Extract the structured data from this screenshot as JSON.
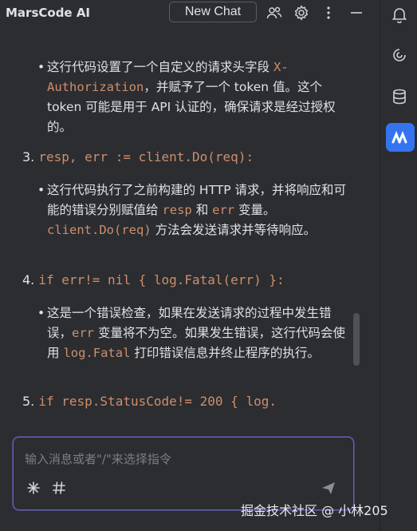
{
  "header": {
    "app_title": "MarsCode AI",
    "new_chat_label": "New Chat",
    "icons": [
      "users-icon",
      "gear-icon",
      "more-vertical-icon",
      "minimize-icon"
    ]
  },
  "rail": {
    "icons": [
      "bell-icon",
      "swirl-icon",
      "database-icon",
      "marscode-logo-icon"
    ]
  },
  "conversation": {
    "item2_bullet": {
      "p1": "这行代码设置了一个自定义的请求头字段 ",
      "code1": "X-Authorization",
      "p2": "，并赋予了一个 token 值。这个 token 可能是用于 API 认证的，确保请求是经过授权的。"
    },
    "item3": {
      "number": "3.",
      "code": "resp, err := client.Do(req):",
      "bullet": {
        "p1": "这行代码执行了之前构建的 HTTP 请求，并将响应和可能的错误分别赋值给 ",
        "code1": "resp",
        "p2": " 和 ",
        "code2": "err",
        "p3": " 变量。",
        "code3": "client.Do(req)",
        "p4": " 方法会发送请求并等待响应。"
      }
    },
    "item4": {
      "number": "4.",
      "code": "if err!= nil { log.Fatal(err) }:",
      "bullet": {
        "p1": "这是一个错误检查，如果在发送请求的过程中发生错误，",
        "code1": "err",
        "p2": " 变量将不为空。如果发生错误，这行代码会使用 ",
        "code2": "log.Fatal",
        "p3": " 打印错误信息并终止程序的执行。"
      }
    },
    "item5": {
      "number": "5.",
      "code": "if resp.StatusCode!= 200 { log."
    }
  },
  "input": {
    "placeholder": "输入消息或者\"/\"来选择指令",
    "tools": [
      "sparkle-icon",
      "hash-icon",
      "send-icon"
    ]
  },
  "watermark": "掘金技术社区 @ 小林205",
  "colors": {
    "background": "#2b2d30",
    "text": "#dfe1e5",
    "code": "#cf8e6d",
    "accent": "#3574f0",
    "input_border": "#6d5bd0",
    "placeholder": "#7b7e85"
  }
}
